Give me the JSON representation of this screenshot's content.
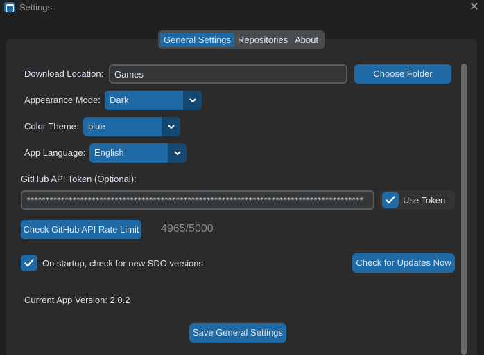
{
  "window": {
    "title": "Settings",
    "close_symbol": "✕"
  },
  "tabs": [
    {
      "label": "General Settings",
      "active": true
    },
    {
      "label": "Repositories",
      "active": false
    },
    {
      "label": "About",
      "active": false
    }
  ],
  "download": {
    "label": "Download Location:",
    "value": "Games",
    "button": "Choose Folder"
  },
  "appearance": {
    "label": "Appearance Mode:",
    "value": "Dark"
  },
  "theme": {
    "label": "Color Theme:",
    "value": "blue"
  },
  "language": {
    "label": "App Language:",
    "value": "English"
  },
  "token": {
    "label": "GitHub API Token (Optional):",
    "masked_value": "****************************************************************************************",
    "use_token_label": "Use Token",
    "use_token_checked": true
  },
  "rate_limit": {
    "button": "Check GitHub API Rate Limit",
    "value": "4965/5000"
  },
  "startup_check": {
    "label": "On startup, check for new SDO versions",
    "checked": true
  },
  "updates_button": "Check for Updates Now",
  "version": {
    "label": "Current App Version: 2.0.2"
  },
  "save_button": "Save General Settings",
  "colors": {
    "accent": "#1f6aa5",
    "accent_dark": "#144870",
    "background": "#202020",
    "panel": "#2b2b2b"
  }
}
